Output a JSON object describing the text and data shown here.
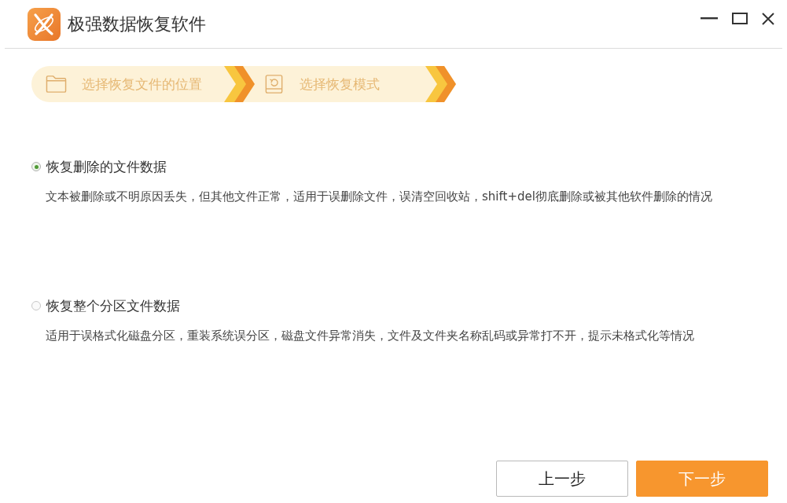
{
  "window": {
    "title": "极强数据恢复软件"
  },
  "steps": [
    {
      "label": "选择恢复文件的位置",
      "kind": "location"
    },
    {
      "label": "选择恢复模式",
      "kind": "mode"
    }
  ],
  "options": [
    {
      "label": "恢复删除的文件数据",
      "description": "文本被删除或不明原因丢失，但其他文件正常，适用于误删除文件，误清空回收站，shift+del彻底删除或被其他软件删除的情况",
      "selected": true
    },
    {
      "label": "恢复整个分区文件数据",
      "description": "适用于误格式化磁盘分区，重装系统误分区，磁盘文件异常消失，文件及文件夹名称乱码或异常打不开，提示未格式化等情况",
      "selected": false
    }
  ],
  "buttons": [
    {
      "label": "上一步",
      "kind": "secondary"
    },
    {
      "label": "下一步",
      "kind": "primary"
    }
  ]
}
